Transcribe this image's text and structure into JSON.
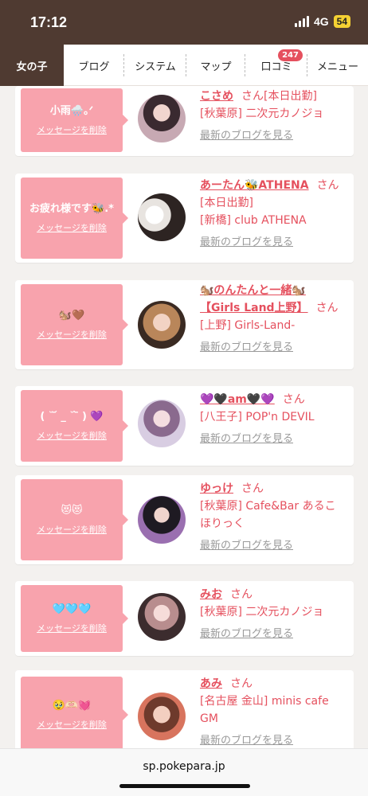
{
  "status": {
    "time": "17:12",
    "network": "4G",
    "battery": "54"
  },
  "nav": {
    "items": [
      {
        "label": "女の子",
        "active": true
      },
      {
        "label": "ブログ"
      },
      {
        "label": "システム"
      },
      {
        "label": "マップ"
      },
      {
        "label": "口コミ",
        "badge": "247"
      },
      {
        "label": "メニュー"
      }
    ]
  },
  "cards": [
    {
      "message": "小雨🌧️｡ᐟ",
      "delete_label": "メッセージを削除",
      "name": "こさめ",
      "san": "さん",
      "status": "[本日出勤]",
      "shop": "[秋葉原] 二次元カノジョ",
      "blog_link": "最新のブログを見る"
    },
    {
      "message": "お疲れ様です🐝.*",
      "delete_label": "メッセージを削除",
      "name": "あーたん🐝ATHENA",
      "san": "さん",
      "status": "[本日出勤]",
      "shop": "[新橋] club ATHENA",
      "blog_link": "最新のブログを見る"
    },
    {
      "message": "🐿️🤎",
      "delete_label": "メッセージを削除",
      "name": "🐿️のんたんと一緒🐿️【Girls Land上野】",
      "san": "さん",
      "status": "",
      "shop": "[上野] Girls-Land-",
      "blog_link": "最新のブログを見る"
    },
    {
      "message": "( ˘ ᷄ _ ˘ ᷅ ) 💜",
      "delete_label": "メッセージを削除",
      "name": "💜🖤am🖤💜",
      "san": "さん",
      "status": "",
      "shop": "[八王子] POP'n DEVIL",
      "blog_link": "最新のブログを見る"
    },
    {
      "message": "😻😻",
      "delete_label": "メッセージを削除",
      "name": "ゆっけ",
      "san": "さん",
      "status": "",
      "shop": "[秋葉原] Cafe&Bar あるこほりっく",
      "blog_link": "最新のブログを見る"
    },
    {
      "message": "🩵🩵🩵",
      "delete_label": "メッセージを削除",
      "name": "みお",
      "san": "さん",
      "status": "",
      "shop": "[秋葉原] 二次元カノジョ",
      "blog_link": "最新のブログを見る"
    },
    {
      "message": "🥹🫶🏻💓",
      "delete_label": "メッセージを削除",
      "name": "あみ",
      "san": "さん",
      "status": "",
      "shop": "[名古屋 金山] minis cafe GM",
      "blog_link": "最新のブログを見る"
    }
  ],
  "url_bar": {
    "url": "sp.pokepara.jp"
  }
}
